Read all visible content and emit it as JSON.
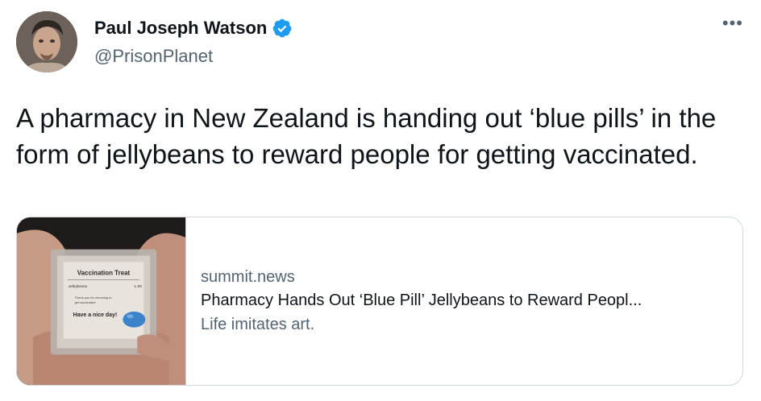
{
  "author": {
    "display_name": "Paul Joseph Watson",
    "handle": "@PrisonPlanet",
    "verified": true,
    "avatar_icon": "profile-photo"
  },
  "menu": {
    "more_label": "•••"
  },
  "tweet": {
    "text": "A pharmacy in New Zealand is handing out ‘blue pills’ in the form of jellybeans to reward people for getting vaccinated."
  },
  "link_card": {
    "domain": "summit.news",
    "title": "Pharmacy Hands Out ‘Blue Pill’ Jellybeans to Reward Peopl...",
    "description": "Life imitates art.",
    "thumbnail_label": "Vaccination Treat",
    "thumbnail_text": [
      "Jellybeans",
      "1.00",
      "Thank you for choosing to",
      "get vaccinated",
      "Have a nice day!"
    ]
  },
  "colors": {
    "text_primary": "#0f1419",
    "text_secondary": "#536471",
    "verified_blue": "#1d9bf0",
    "border": "#cfd9de"
  }
}
